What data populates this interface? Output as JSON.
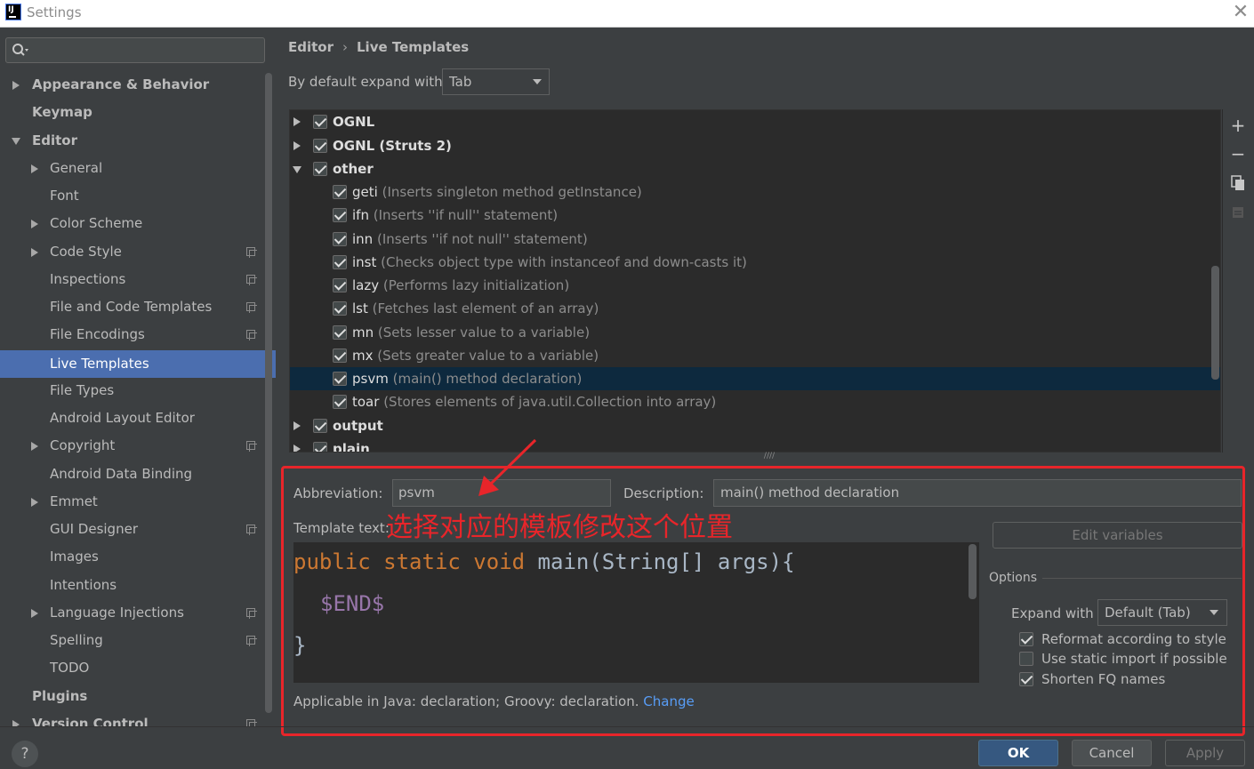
{
  "window": {
    "title": "Settings"
  },
  "search": {
    "placeholder": ""
  },
  "sidebar": {
    "items": [
      {
        "label": "Appearance & Behavior"
      },
      {
        "label": "Keymap"
      },
      {
        "label": "Editor"
      },
      {
        "label": "General"
      },
      {
        "label": "Font"
      },
      {
        "label": "Color Scheme"
      },
      {
        "label": "Code Style"
      },
      {
        "label": "Inspections"
      },
      {
        "label": "File and Code Templates"
      },
      {
        "label": "File Encodings"
      },
      {
        "label": "Live Templates"
      },
      {
        "label": "File Types"
      },
      {
        "label": "Android Layout Editor"
      },
      {
        "label": "Copyright"
      },
      {
        "label": "Android Data Binding"
      },
      {
        "label": "Emmet"
      },
      {
        "label": "GUI Designer"
      },
      {
        "label": "Images"
      },
      {
        "label": "Intentions"
      },
      {
        "label": "Language Injections"
      },
      {
        "label": "Spelling"
      },
      {
        "label": "TODO"
      },
      {
        "label": "Plugins"
      },
      {
        "label": "Version Control"
      }
    ]
  },
  "breadcrumb": {
    "parent": "Editor",
    "separator": "›",
    "current": "Live Templates"
  },
  "expand": {
    "label": "By default expand with",
    "value": "Tab"
  },
  "tree": {
    "groups": [
      {
        "name": "OGNL"
      },
      {
        "name": "OGNL (Struts 2)"
      },
      {
        "name": "other"
      },
      {
        "name": "output"
      },
      {
        "name": "plain"
      }
    ],
    "templates": [
      {
        "abbr": "geti",
        "desc": "(Inserts singleton method getInstance)"
      },
      {
        "abbr": "ifn",
        "desc": "(Inserts ''if null'' statement)"
      },
      {
        "abbr": "inn",
        "desc": "(Inserts ''if not null'' statement)"
      },
      {
        "abbr": "inst",
        "desc": "(Checks object type with instanceof and down-casts it)"
      },
      {
        "abbr": "lazy",
        "desc": "(Performs lazy initialization)"
      },
      {
        "abbr": "lst",
        "desc": "(Fetches last element of an array)"
      },
      {
        "abbr": "mn",
        "desc": "(Sets lesser value to a variable)"
      },
      {
        "abbr": "mx",
        "desc": "(Sets greater value to a variable)"
      },
      {
        "abbr": "psvm",
        "desc": "(main() method declaration)"
      },
      {
        "abbr": "toar",
        "desc": "(Stores elements of java.util.Collection into array)"
      }
    ]
  },
  "editor": {
    "abbreviation_label": "Abbreviation:",
    "abbreviation_value": "psvm",
    "description_label": "Description:",
    "description_value": "main() method declaration",
    "template_text_label": "Template text:",
    "code_lines": {
      "line1_kw": "public static void",
      "line1_rest": " main(String[] args){",
      "line2": "$END$",
      "line3": "}"
    },
    "applicable_text": "Applicable in Java: declaration; Groovy: declaration.",
    "change_link": "Change"
  },
  "annotation": {
    "text": "选择对应的模板修改这个位置",
    "color": "#e8252a"
  },
  "options": {
    "edit_variables": "Edit variables",
    "title": "Options",
    "expand_with_label": "Expand with",
    "expand_with_value": "Default (Tab)",
    "reformat": "Reformat according to style",
    "static_import": "Use static import if possible",
    "shorten_fq": "Shorten FQ names"
  },
  "footer": {
    "help": "?",
    "ok": "OK",
    "cancel": "Cancel",
    "apply": "Apply"
  },
  "colors": {
    "selection": "#4b6eaf",
    "tree_selection": "#0d293e",
    "keyword": "#cc7832",
    "variable": "#9876aa",
    "link": "#589df6"
  }
}
